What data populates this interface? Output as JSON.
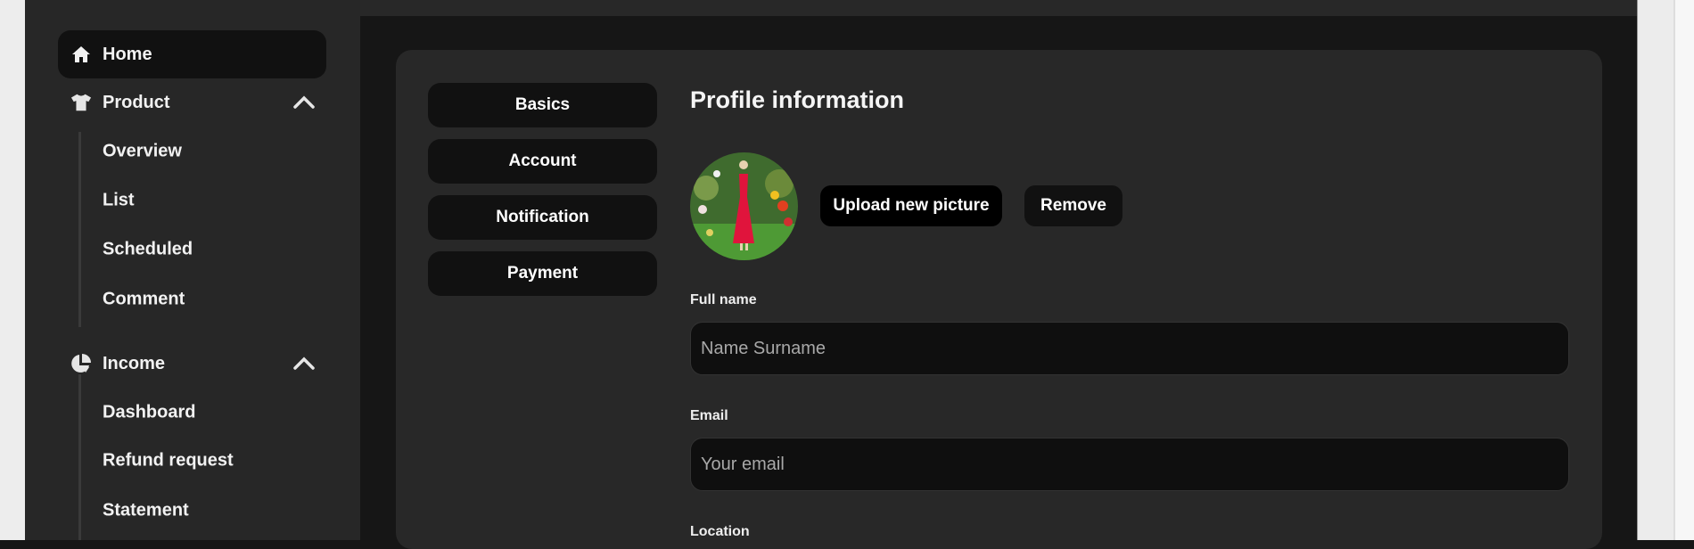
{
  "sidebar": {
    "home": "Home",
    "product": {
      "label": "Product",
      "items": [
        "Overview",
        "List",
        "Scheduled",
        "Comment"
      ]
    },
    "income": {
      "label": "Income",
      "items": [
        "Dashboard",
        "Refund request",
        "Statement"
      ]
    }
  },
  "settings": {
    "tabs": [
      "Basics",
      "Account",
      "Notification",
      "Payment"
    ],
    "title": "Profile information",
    "upload_label": "Upload new picture",
    "remove_label": "Remove",
    "fields": {
      "full_name": {
        "label": "Full name",
        "placeholder": "Name Surname",
        "value": ""
      },
      "email": {
        "label": "Email",
        "placeholder": "Your email",
        "value": ""
      },
      "location": {
        "label": "Location"
      }
    }
  },
  "colors": {
    "sidebar": "#272727",
    "background": "#161616",
    "card": "#282828",
    "button": "#111111"
  }
}
